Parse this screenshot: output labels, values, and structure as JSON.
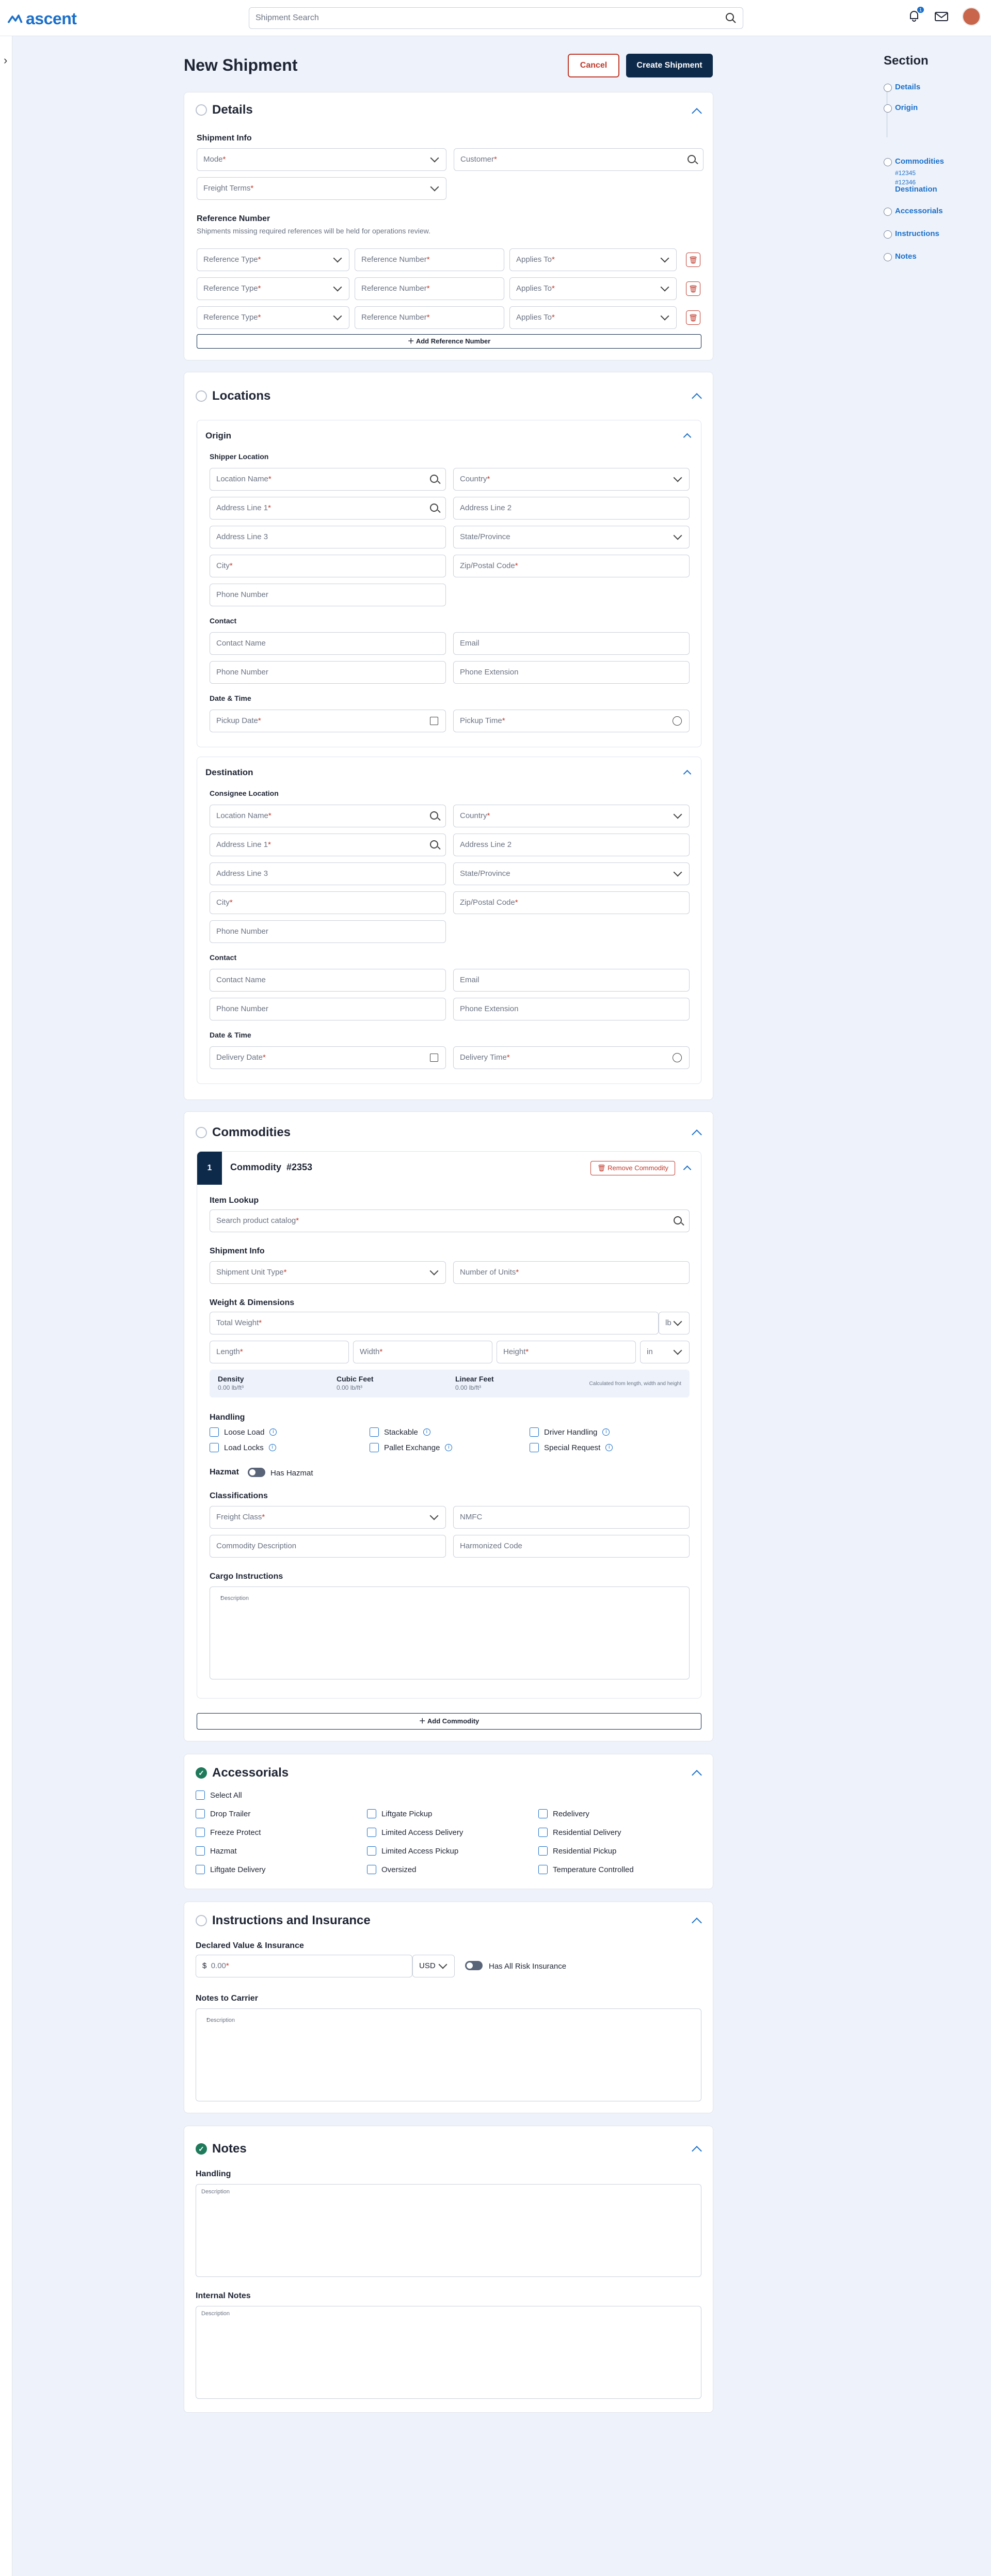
{
  "app": {
    "logo": "ascent",
    "search_placeholder": "Shipment Search",
    "notifications_count": "1"
  },
  "page": {
    "title": "New Shipment",
    "cancel": "Cancel",
    "create": "Create Shipment"
  },
  "nav": {
    "title": "Section",
    "items": [
      "Details",
      "Origin",
      "Commodities",
      "Destination",
      "Accessorials",
      "Instructions",
      "Notes"
    ],
    "subs": [
      "#12345",
      "#12346"
    ]
  },
  "details": {
    "title": "Details",
    "shipment_info": "Shipment Info",
    "mode": "Mode",
    "customer": "Customer",
    "freight_terms": "Freight Terms",
    "ref_title": "Reference Number",
    "ref_note": "Shipments missing required references will be held for operations review.",
    "ref_type": "Reference Type",
    "ref_number": "Reference Number",
    "applies_to": "Applies To",
    "add_ref": "Add Reference Number"
  },
  "locations": {
    "title": "Locations",
    "origin": {
      "title": "Origin",
      "loc_title": "Shipper Location",
      "date_lbl": "Pickup Date",
      "time_lbl": "Pickup Time"
    },
    "destination": {
      "title": "Destination",
      "loc_title": "Consignee Location",
      "date_lbl": "Delivery Date",
      "time_lbl": "Delivery Time"
    },
    "location_name": "Location Name",
    "country": "Country",
    "address1": "Address Line 1",
    "address2": "Address Line 2",
    "address3": "Address Line 3",
    "state": "State/Province",
    "city": "City",
    "zip": "Zip/Postal Code",
    "phone": "Phone Number",
    "contact": "Contact",
    "contact_name": "Contact Name",
    "email": "Email",
    "phone_ext": "Phone Extension",
    "date_time": "Date & Time"
  },
  "commodities": {
    "title": "Commodities",
    "index": "1",
    "name": "Commodity",
    "number": "#2353",
    "remove": "Remove Commodity",
    "item_lookup": "Item Lookup",
    "catalog": "Search product catalog",
    "shipment_info": "Shipment Info",
    "unit_type": "Shipment Unit Type",
    "units": "Number of Units",
    "wd": "Weight & Dimensions",
    "total_weight": "Total Weight",
    "lb": "lb",
    "length": "Length",
    "width": "Width",
    "height": "Height",
    "in": "in",
    "density": "Density",
    "density_v": "0.00 lb/ft³",
    "cubic": "Cubic Feet",
    "cubic_v": "0.00 lb/ft³",
    "linear": "Linear Feet",
    "linear_v": "0.00 lb/ft³",
    "calc_note": "Calculated from length, width and height",
    "handling": "Handling",
    "handling_opts": [
      "Loose Load",
      "Stackable",
      "Driver Handling",
      "Load Locks",
      "Pallet Exchange",
      "Special Request"
    ],
    "hazmat": "Hazmat",
    "has_hazmat": "Has Hazmat",
    "classifications": "Classifications",
    "freight_class": "Freight Class",
    "nmfc": "NMFC",
    "desc": "Commodity Description",
    "hcode": "Harmonized Code",
    "cargo": "Cargo Instructions",
    "description": "Description",
    "add": "Add Commodity"
  },
  "accessorials": {
    "title": "Accessorials",
    "select_all": "Select All",
    "opts": [
      "Drop Trailer",
      "Liftgate Pickup",
      "Redelivery",
      "Freeze Protect",
      "Limited Access Delivery",
      "Residential Delivery",
      "Hazmat",
      "Limited Access Pickup",
      "Residential Pickup",
      "Liftgate Delivery",
      "Oversized",
      "Temperature Controlled"
    ]
  },
  "instructions": {
    "title": "Instructions and Insurance",
    "declared": "Declared Value & Insurance",
    "currency_symbol": "$",
    "amount": "0.00",
    "currency": "USD",
    "all_risk": "Has All Risk Insurance",
    "notes_carrier": "Notes to Carrier",
    "description": "Description"
  },
  "notes": {
    "title": "Notes",
    "handling": "Handling",
    "internal": "Internal Notes",
    "description": "Description"
  }
}
